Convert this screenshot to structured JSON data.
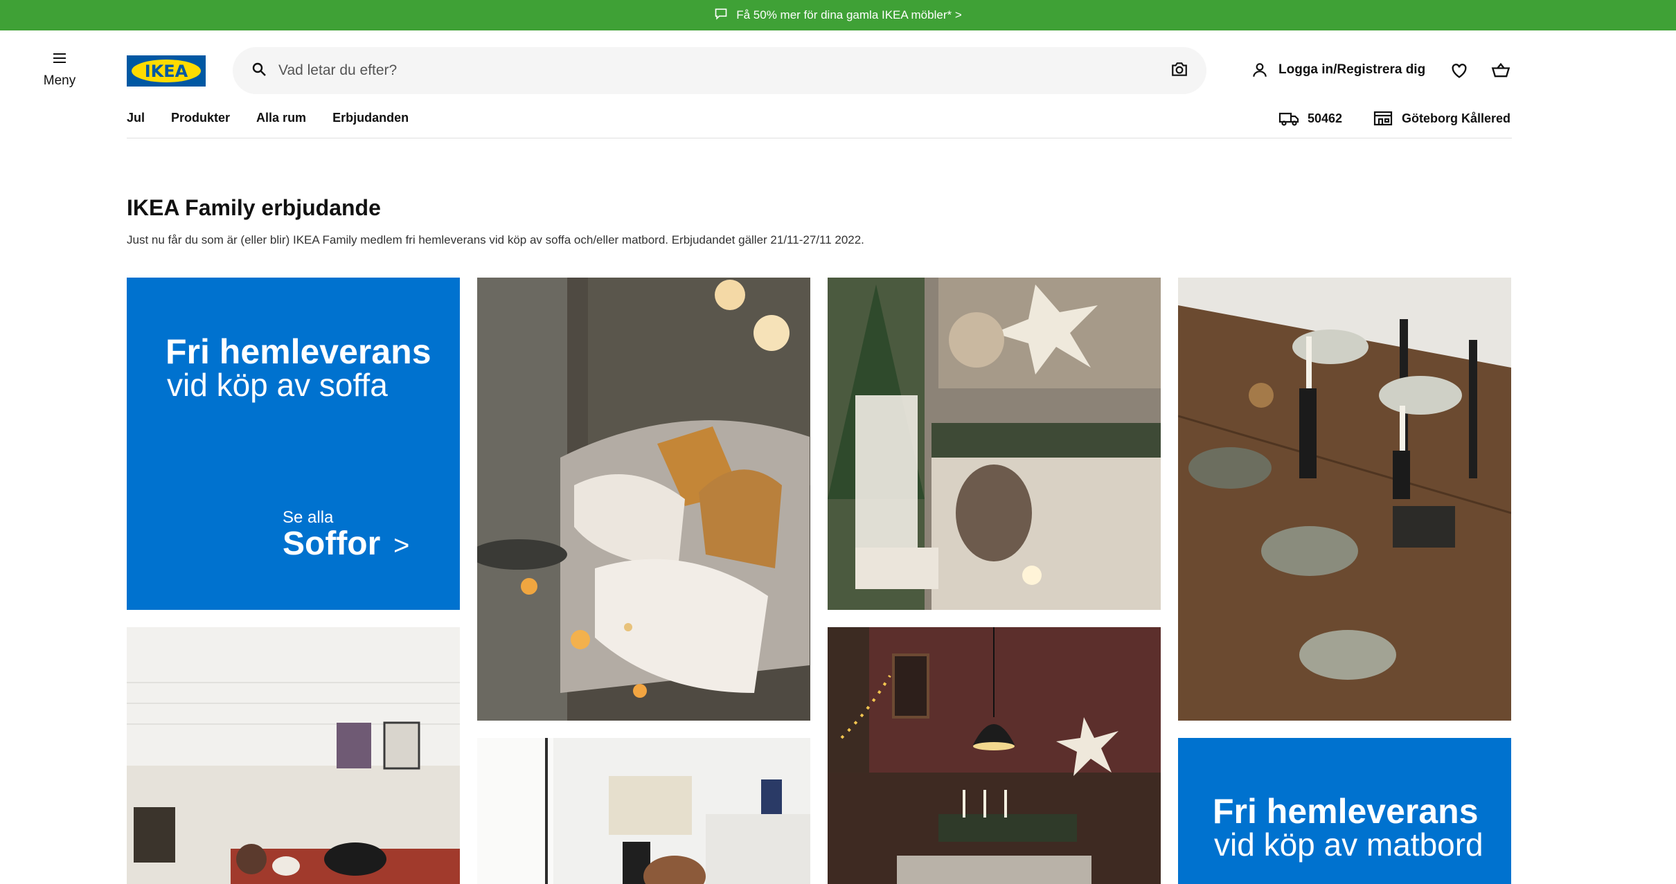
{
  "promo": {
    "text": "Få 50% mer för dina gamla IKEA möbler* >"
  },
  "header": {
    "menu_label": "Meny",
    "logo_text": "IKEA",
    "search_placeholder": "Vad letar du efter?",
    "login_label": "Logga in/Registrera dig"
  },
  "nav": {
    "items": [
      "Jul",
      "Produkter",
      "Alla rum",
      "Erbjudanden"
    ],
    "postal_code": "50462",
    "store": "Göteborg Kållered"
  },
  "main": {
    "title": "IKEA Family erbjudande",
    "description": "Just nu får du som är (eller blir) IKEA Family medlem fri hemleverans vid köp av soffa och/eller matbord. Erbjudandet gäller 21/11-27/11 2022.",
    "tile_sofa": {
      "headline": "Fri hemleverans",
      "subline": "vid köp av soffa",
      "cta_small": "Se alla",
      "cta_big": "Soffor",
      "cta_arrow": ">"
    },
    "tile_table": {
      "headline": "Fri hemleverans",
      "subline": "vid köp av matbord"
    }
  },
  "colors": {
    "promo_green": "#3fa136",
    "tile_blue": "#0072cf",
    "ikea_blue": "#0058a3",
    "ikea_yellow": "#ffdb00"
  },
  "icons": [
    "chat-icon",
    "hamburger-icon",
    "search-icon",
    "camera-icon",
    "user-icon",
    "heart-icon",
    "cart-icon",
    "truck-icon",
    "store-icon"
  ]
}
